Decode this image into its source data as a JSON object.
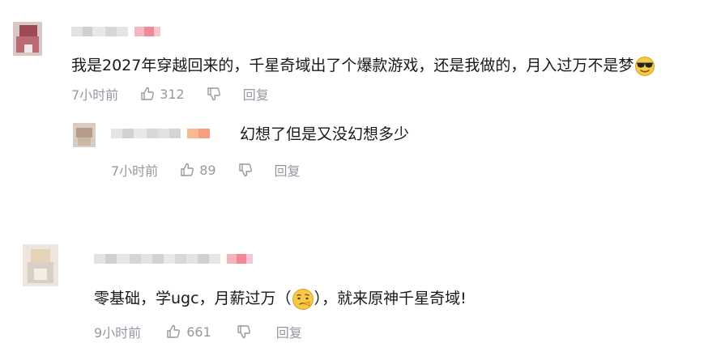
{
  "comments": [
    {
      "text": "我是2027年穿越回来的，千星奇域出了个爆款游戏，还是我做的，月入过万不是梦",
      "emoji": "sunglasses-face",
      "time": "7小时前",
      "likes": "312",
      "reply_label": "回复",
      "replies": [
        {
          "text": "幻想了但是又没幻想多少",
          "time": "7小时前",
          "likes": "89",
          "reply_label": "回复"
        }
      ]
    },
    {
      "text_before": "零基础，学ugc，月薪过万（",
      "emoji": "doubtful-face",
      "text_after": "），就来原神千星奇域!",
      "time": "9小时前",
      "likes": "661",
      "reply_label": "回复"
    }
  ],
  "colors": {
    "text": "#18191c",
    "meta": "#9499a0",
    "badge": "#f25d8e"
  },
  "icons": [
    "thumbs-up-icon",
    "thumbs-down-icon",
    "sunglasses-emoji",
    "doubtful-emoji"
  ]
}
